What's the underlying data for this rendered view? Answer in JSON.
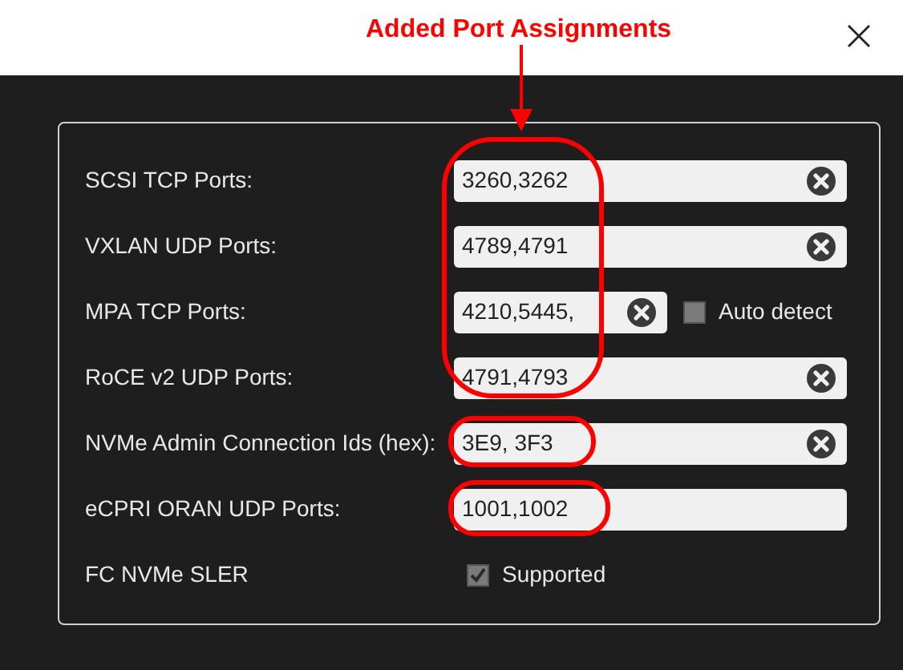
{
  "annotation": {
    "label": "Added Port Assignments"
  },
  "rows": [
    {
      "kind": "field",
      "label": "SCSI TCP Ports:",
      "value": "3260,3262",
      "clearable": true
    },
    {
      "kind": "field",
      "label": "VXLAN UDP Ports:",
      "value": "4789,4791",
      "clearable": true
    },
    {
      "kind": "field-check",
      "label": "MPA TCP Ports:",
      "value": "4210,5445,",
      "clearable": true,
      "check_label": "Auto detect",
      "checked": false
    },
    {
      "kind": "field",
      "label": "RoCE v2 UDP Ports:",
      "value": "4791,4793",
      "clearable": true
    },
    {
      "kind": "field",
      "label": "NVMe Admin Connection Ids (hex):",
      "value": "3E9, 3F3",
      "clearable": true
    },
    {
      "kind": "field",
      "label": "eCPRI ORAN UDP Ports:",
      "value": "1001,1002",
      "clearable": false
    },
    {
      "kind": "check",
      "label": "FC NVMe SLER",
      "check_label": "Supported",
      "checked": true
    }
  ]
}
